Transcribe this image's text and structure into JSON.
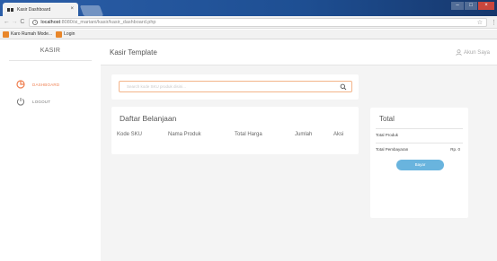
{
  "browser": {
    "tab_title": "Kasir Dashboard",
    "tab_close": "×",
    "url_host": "localhost",
    "url_path": ":8080/si_mariani/kasir/kasir_dashboard.php",
    "bookmarks": [
      {
        "label": "Karo Rumah Mode..."
      },
      {
        "label": "Login"
      }
    ]
  },
  "sidebar": {
    "brand": "KASIR",
    "items": [
      {
        "label": "DASHBOARD",
        "icon": "pie-chart-icon",
        "active": true,
        "color": "#ef7f50"
      },
      {
        "label": "LOGOUT",
        "icon": "power-icon",
        "active": false,
        "color": "#777777"
      }
    ]
  },
  "header": {
    "title": "Kasir Template",
    "account": "Akun Saya"
  },
  "search": {
    "placeholder": "Search kode SKU produk disini..."
  },
  "cart": {
    "title": "Daftar Belanjaan",
    "columns": [
      "Kode SKU",
      "Nama Produk",
      "Total Harga",
      "Jumlah",
      "Aksi"
    ]
  },
  "total": {
    "title": "Total",
    "total_produk_label": "Total Produk",
    "total_pembayaran_label": "Total Pembayaran",
    "total_pembayaran_value": "Rp. 0",
    "pay_button": "Bayar"
  },
  "colors": {
    "accent": "#ef7f50",
    "button": "#69b4de",
    "title_bar": "#1e4f93"
  }
}
